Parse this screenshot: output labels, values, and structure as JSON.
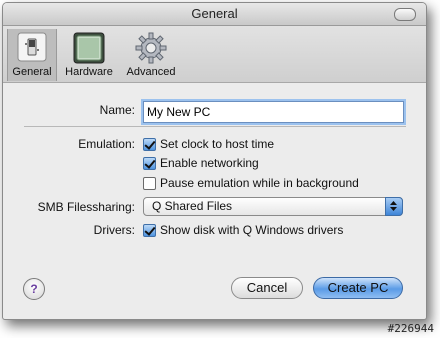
{
  "window": {
    "title": "General"
  },
  "toolbar": {
    "items": [
      {
        "label": "General",
        "icon": "switch-icon",
        "selected": true
      },
      {
        "label": "Hardware",
        "icon": "hardware-icon",
        "selected": false
      },
      {
        "label": "Advanced",
        "icon": "gear-icon",
        "selected": false
      }
    ]
  },
  "form": {
    "name_label": "Name:",
    "name_value": "My New PC",
    "emulation_label": "Emulation:",
    "options": [
      {
        "label": "Set clock to host time",
        "checked": true
      },
      {
        "label": "Enable networking",
        "checked": true
      },
      {
        "label": "Pause emulation while in background",
        "checked": false
      }
    ],
    "smb_label": "SMB Filessharing:",
    "smb_value": "Q Shared Files",
    "drivers_label": "Drivers:",
    "drivers_option": {
      "label": "Show disk with Q Windows drivers",
      "checked": true
    }
  },
  "footer": {
    "help_label": "?",
    "cancel_label": "Cancel",
    "create_label": "Create PC"
  },
  "watermark": "#226944",
  "colors": {
    "accent": "#4f94e0",
    "focus_ring": "#9cc2ee"
  }
}
